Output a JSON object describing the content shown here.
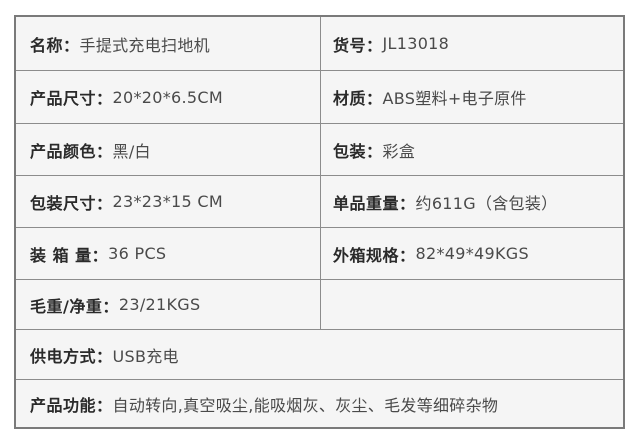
{
  "specs": {
    "rows": [
      {
        "left": {
          "label": "名称：",
          "value": "手提式充电扫地机"
        },
        "right": {
          "label": "货号：",
          "value": "JL13018"
        }
      },
      {
        "left": {
          "label": "产品尺寸：",
          "value": "20*20*6.5CM"
        },
        "right": {
          "label": "材质：",
          "value": "ABS塑料+电子原件"
        }
      },
      {
        "left": {
          "label": "产品颜色：",
          "value": "黑/白"
        },
        "right": {
          "label": "包装：",
          "value": "彩盒"
        }
      },
      {
        "left": {
          "label": "包装尺寸：",
          "value": " 23*23*15 CM"
        },
        "right": {
          "label": "单品重量：",
          "value": "约611G（含包装）"
        }
      },
      {
        "left": {
          "label": "装 箱 量：",
          "value": "36 PCS"
        },
        "right": {
          "label": "外箱规格：",
          "value": "82*49*49KGS"
        }
      },
      {
        "left": {
          "label": "毛重/净重：",
          "value": "23/21KGS"
        },
        "right": {
          "label": "",
          "value": ""
        }
      }
    ],
    "power": {
      "label": "供电方式：",
      "value": "USB充电"
    },
    "function": {
      "label": "产品功能：",
      "value": "自动转向,真空吸尘,能吸烟灰、灰尘、毛发等细碎杂物"
    }
  }
}
